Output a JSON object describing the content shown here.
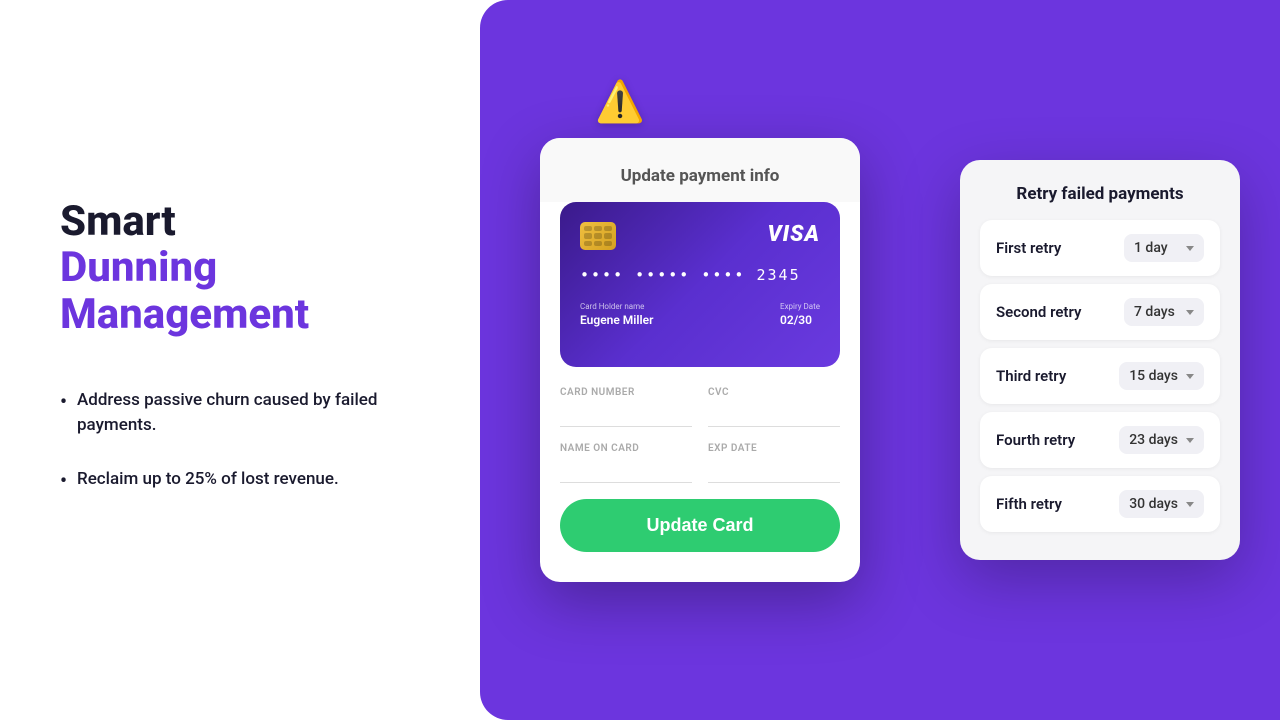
{
  "left": {
    "heading_line1": "Smart",
    "heading_line2": "Dunning",
    "heading_line3": "Management",
    "bullets": [
      "Address passive churn caused by failed payments.",
      "Reclaim up to 25% of lost revenue."
    ]
  },
  "payment_modal": {
    "header": "Update payment info",
    "card": {
      "number": "•••• ••••• •••• 2345",
      "brand": "VISA",
      "holder_label": "Card Holder name",
      "holder_name": "Eugene Miller",
      "expiry_label": "Expiry Date",
      "expiry_date": "02/30"
    },
    "fields": {
      "card_number_label": "CARD NUMBER",
      "cvc_label": "CVC",
      "name_label": "NAME ON CARD",
      "exp_label": "EXP DATE"
    },
    "button_label": "Update Card"
  },
  "retry_panel": {
    "title": "Retry failed payments",
    "rows": [
      {
        "label": "First retry",
        "value": "1 day"
      },
      {
        "label": "Second retry",
        "value": "7 days"
      },
      {
        "label": "Third retry",
        "value": "15 days"
      },
      {
        "label": "Fourth retry",
        "value": "23 days"
      },
      {
        "label": "Fifth retry",
        "value": "30 days"
      }
    ]
  },
  "icons": {
    "warning": "⚠️",
    "chevron": "▾"
  }
}
